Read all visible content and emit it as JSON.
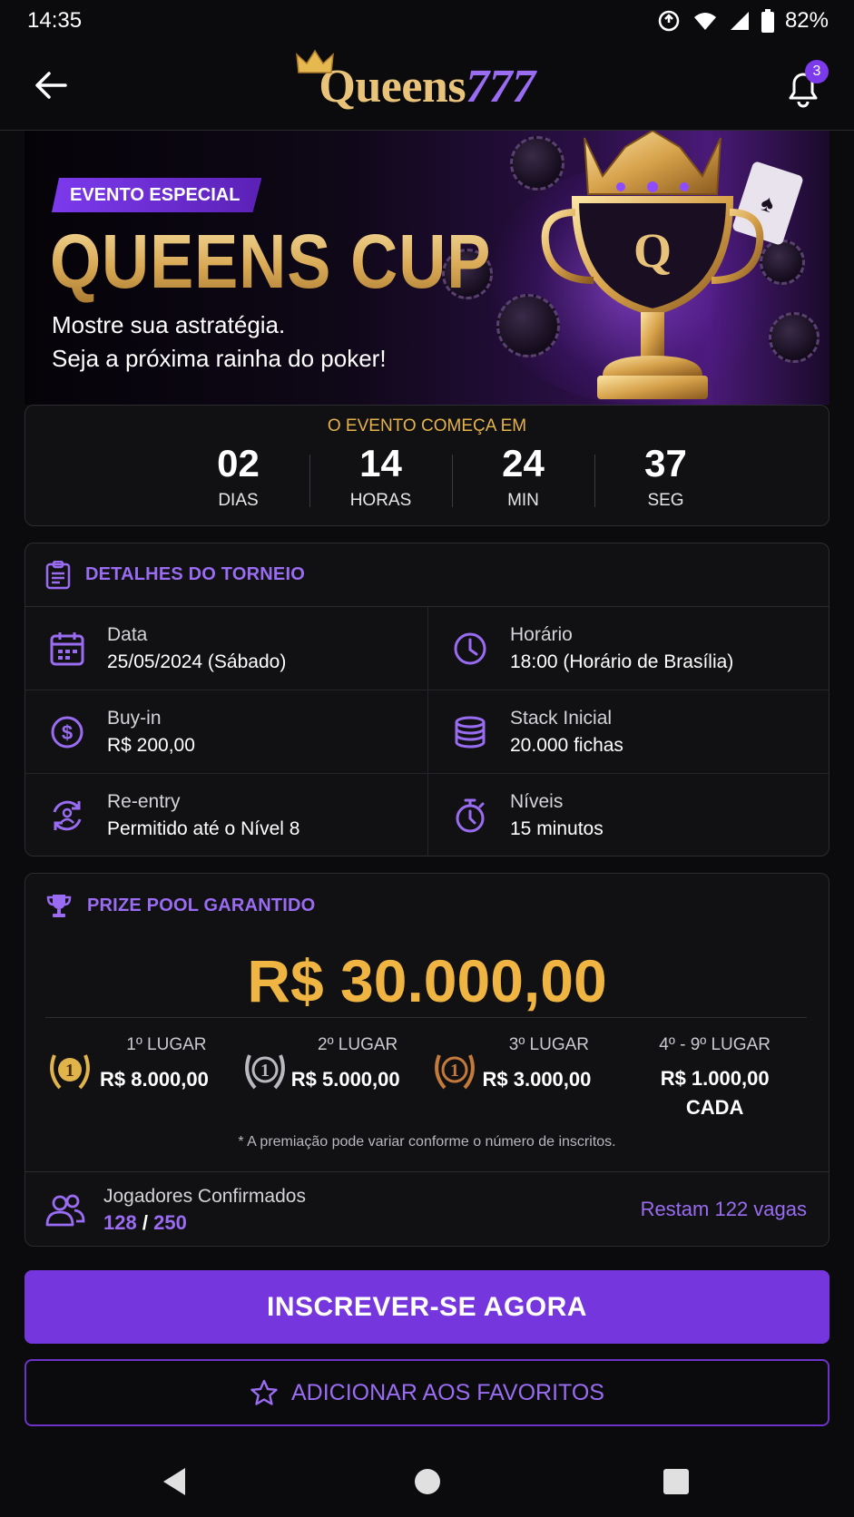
{
  "status_bar": {
    "time": "14:35",
    "battery": "82%"
  },
  "app_bar": {
    "logo_part1": "Queens",
    "logo_part2": "777",
    "notification_count": "3"
  },
  "hero": {
    "tag": "EVENTO ESPECIAL",
    "title": "QUEENS CUP",
    "subtitle_line1": "Mostre sua astratégia.",
    "subtitle_line2": "Seja a próxima rainha do poker!"
  },
  "countdown": {
    "title": "O EVENTO COMEÇA EM",
    "units": [
      {
        "value": "02",
        "label": "DIAS"
      },
      {
        "value": "14",
        "label": "HORAS"
      },
      {
        "value": "24",
        "label": "MIN"
      },
      {
        "value": "37",
        "label": "SEG"
      }
    ]
  },
  "details": {
    "title": "DETALHES DO TORNEIO",
    "items": [
      {
        "label": "Data",
        "value": "25/05/2024 (Sábado)",
        "icon": "calendar-icon"
      },
      {
        "label": "Horário",
        "value": "18:00 (Horário de Brasília)",
        "icon": "clock-icon"
      },
      {
        "label": "Buy-in",
        "value": "R$ 200,00",
        "icon": "dollar-icon"
      },
      {
        "label": "Stack Inicial",
        "value": "20.000 fichas",
        "icon": "chips-stack-icon"
      },
      {
        "label": "Re-entry",
        "value": "Permitido até o Nível 8",
        "icon": "reentry-icon"
      },
      {
        "label": "Níveis",
        "value": "15 minutos",
        "icon": "stopwatch-icon"
      }
    ]
  },
  "prize": {
    "title": "PRIZE POOL GARANTIDO",
    "total": "R$ 30.000,00",
    "places": [
      {
        "label": "1º LUGAR",
        "value": "R$ 8.000,00",
        "medal_color": "#e0b44a"
      },
      {
        "label": "2º LUGAR",
        "value": "R$ 5.000,00",
        "medal_color": "#b9b9c0"
      },
      {
        "label": "3º LUGAR",
        "value": "R$ 3.000,00",
        "medal_color": "#c47a3a"
      },
      {
        "label": "4º - 9º LUGAR",
        "value": "R$ 1.000,00",
        "value2": "CADA"
      }
    ],
    "note": "* A premiação pode variar conforme o número de inscritos."
  },
  "players": {
    "label": "Jogadores Confirmados",
    "confirmed": "128",
    "separator": "/",
    "total": "250",
    "remaining": "Restam 122 vagas"
  },
  "buttons": {
    "register": "INSCREVER-SE AGORA",
    "favorite": "ADICIONAR AOS FAVORITOS"
  },
  "colors": {
    "accent_purple": "#7537dd",
    "gold": "#efb441",
    "background": "#0b0b0d"
  }
}
